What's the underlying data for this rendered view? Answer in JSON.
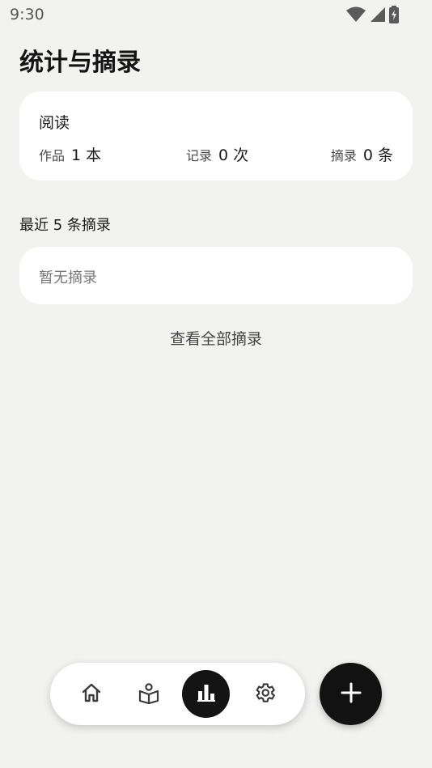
{
  "status_bar": {
    "time": "9:30",
    "icons": [
      "wifi-icon",
      "signal-icon",
      "battery-charging-icon"
    ]
  },
  "page": {
    "title": "统计与摘录"
  },
  "reading_card": {
    "title": "阅读",
    "stats": [
      {
        "label": "作品",
        "value": "1 本"
      },
      {
        "label": "记录",
        "value": "0 次"
      },
      {
        "label": "摘录",
        "value": "0 条"
      }
    ]
  },
  "recent": {
    "title": "最近 5 条摘录",
    "empty_text": "暂无摘录",
    "view_all": "查看全部摘录"
  },
  "bottom_nav": {
    "items": [
      {
        "icon": "home-icon",
        "active": false
      },
      {
        "icon": "book-reader-icon",
        "active": false
      },
      {
        "icon": "bar-chart-icon",
        "active": true
      },
      {
        "icon": "gear-icon",
        "active": false
      }
    ]
  },
  "fab": {
    "icon": "plus-icon"
  },
  "colors": {
    "background": "#f2f2f1",
    "card": "#ffffff",
    "accent_dark": "#141414"
  }
}
